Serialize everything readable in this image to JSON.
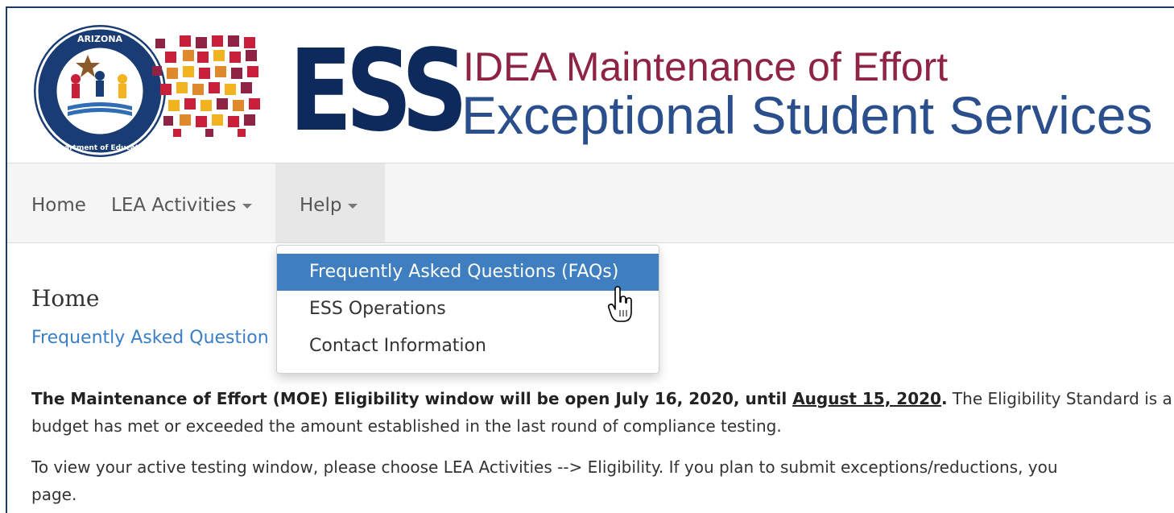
{
  "header": {
    "brand": "ESS",
    "title_line1": "IDEA Maintenance of Effort",
    "title_line2": "Exceptional Student Services",
    "seal_top_text": "ARIZONA",
    "seal_bottom_text": "Department of Education"
  },
  "nav": {
    "items": [
      {
        "label": "Home"
      },
      {
        "label": "LEA Activities"
      },
      {
        "label": "Help"
      }
    ]
  },
  "dropdown": {
    "items": [
      {
        "label": "Frequently Asked Questions (FAQs)"
      },
      {
        "label": "ESS Operations"
      },
      {
        "label": "Contact Information"
      }
    ]
  },
  "content": {
    "page_title": "Home",
    "faq_link": "Frequently Asked Question",
    "para1_bold": "The Maintenance of Effort (MOE) Eligibility window will be open July 16, 2020, until ",
    "para1_date": "August 15, 2020",
    "para1_dot": ".",
    "para1_rest": " The Eligibility Standard is a",
    "para1_line2": "budget has met or exceeded the amount established in the last round of compliance testing.",
    "para2_line1": "To view your active testing window, please choose LEA Activities --> Eligibility. If you plan to submit exceptions/reductions, you",
    "para2_line2": "page."
  },
  "colors": {
    "navy": "#0e2a5c",
    "maroon": "#8e2344",
    "blue": "#2a4f8c",
    "link": "#3a7fc4",
    "hover": "#3f7fbf"
  }
}
